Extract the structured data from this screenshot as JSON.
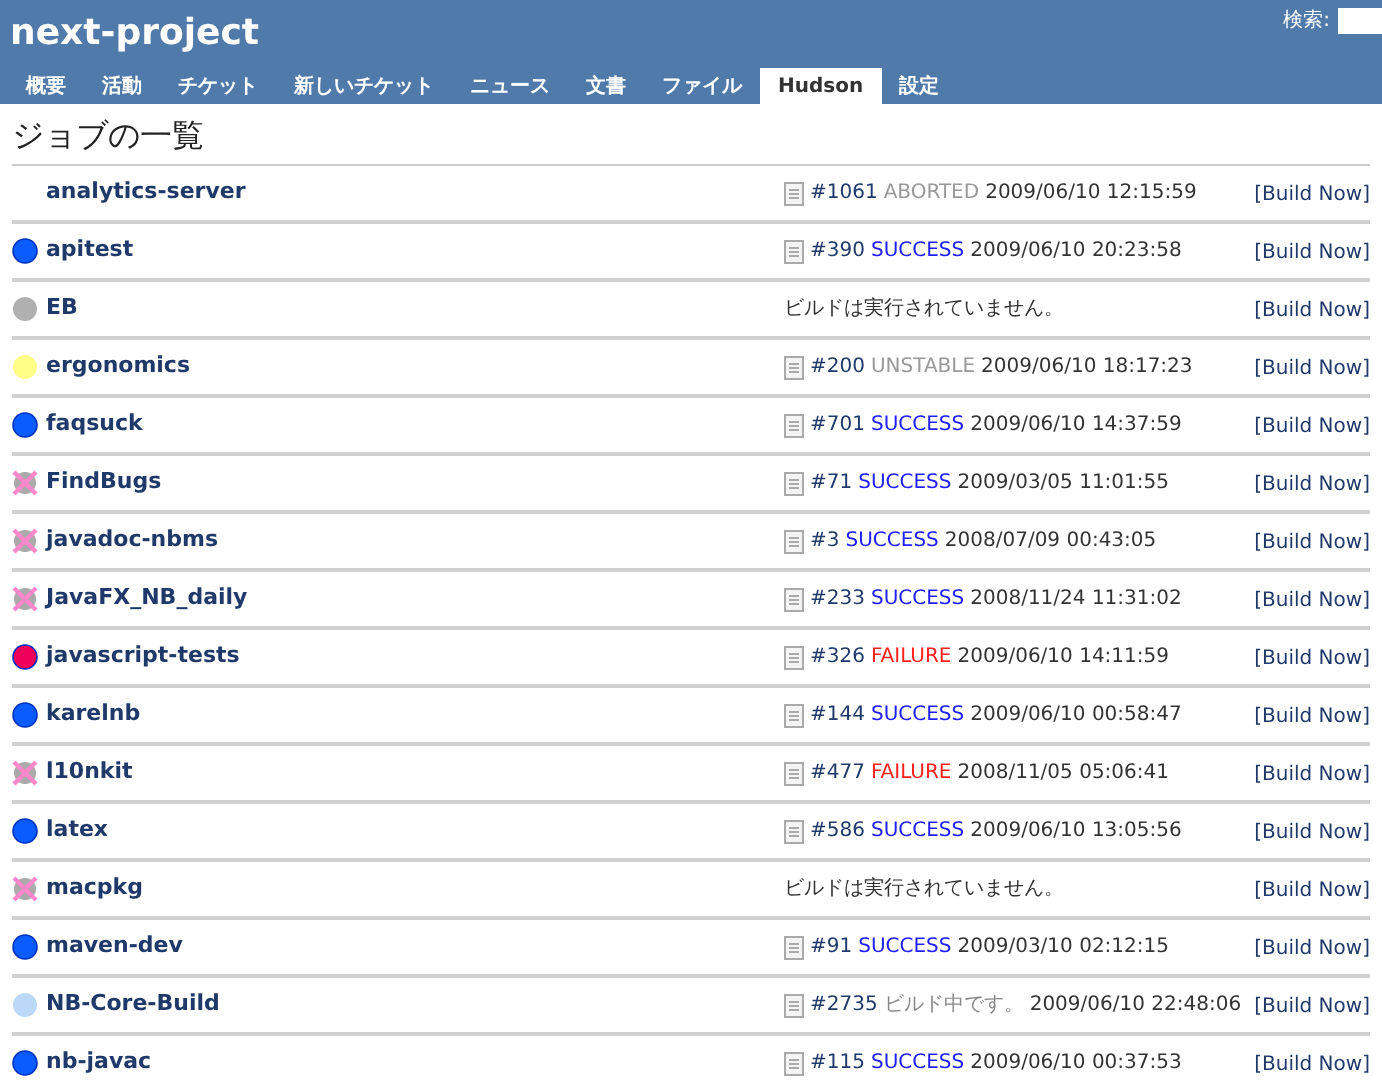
{
  "header": {
    "title": "next-project",
    "search": {
      "label": "検索:"
    }
  },
  "tabs": [
    {
      "label": "概要",
      "selected": false
    },
    {
      "label": "活動",
      "selected": false
    },
    {
      "label": "チケット",
      "selected": false
    },
    {
      "label": "新しいチケット",
      "selected": false
    },
    {
      "label": "ニュース",
      "selected": false
    },
    {
      "label": "文書",
      "selected": false
    },
    {
      "label": "ファイル",
      "selected": false
    },
    {
      "label": "Hudson",
      "selected": true
    },
    {
      "label": "設定",
      "selected": false
    }
  ],
  "heading": "ジョブの一覧",
  "jobs": [
    {
      "name": "analytics-server",
      "kind": "none",
      "build": {
        "number": "#1061",
        "result": "ABORTED",
        "kind": "aborted",
        "time": "2009/06/10 12:15:59"
      },
      "action": "[Build Now]"
    },
    {
      "name": "apitest",
      "kind": "blue",
      "build": {
        "number": "#390",
        "result": "SUCCESS",
        "kind": "success",
        "time": "2009/06/10 20:23:58"
      },
      "action": "[Build Now]"
    },
    {
      "name": "EB",
      "kind": "grey",
      "message": "ビルドは実行されていません。",
      "action": "[Build Now]"
    },
    {
      "name": "ergonomics",
      "kind": "yellow",
      "build": {
        "number": "#200",
        "result": "UNSTABLE",
        "kind": "unstable",
        "time": "2009/06/10 18:17:23"
      },
      "action": "[Build Now]"
    },
    {
      "name": "faqsuck",
      "kind": "blue",
      "build": {
        "number": "#701",
        "result": "SUCCESS",
        "kind": "success",
        "time": "2009/06/10 14:37:59"
      },
      "action": "[Build Now]"
    },
    {
      "name": "FindBugs",
      "kind": "disabled",
      "build": {
        "number": "#71",
        "result": "SUCCESS",
        "kind": "success",
        "time": "2009/03/05 11:01:55"
      },
      "action": "[Build Now]"
    },
    {
      "name": "javadoc-nbms",
      "kind": "disabled",
      "build": {
        "number": "#3",
        "result": "SUCCESS",
        "kind": "success",
        "time": "2008/07/09 00:43:05"
      },
      "action": "[Build Now]"
    },
    {
      "name": "JavaFX_NB_daily",
      "kind": "disabled",
      "build": {
        "number": "#233",
        "result": "SUCCESS",
        "kind": "success",
        "time": "2008/11/24 11:31:02"
      },
      "action": "[Build Now]"
    },
    {
      "name": "javascript-tests",
      "kind": "red",
      "build": {
        "number": "#326",
        "result": "FAILURE",
        "kind": "failure",
        "time": "2009/06/10 14:11:59"
      },
      "action": "[Build Now]"
    },
    {
      "name": "karelnb",
      "kind": "blue",
      "build": {
        "number": "#144",
        "result": "SUCCESS",
        "kind": "success",
        "time": "2009/06/10 00:58:47"
      },
      "action": "[Build Now]"
    },
    {
      "name": "l10nkit",
      "kind": "disabled",
      "build": {
        "number": "#477",
        "result": "FAILURE",
        "kind": "failure",
        "time": "2008/11/05 05:06:41"
      },
      "action": "[Build Now]"
    },
    {
      "name": "latex",
      "kind": "blue",
      "build": {
        "number": "#586",
        "result": "SUCCESS",
        "kind": "success",
        "time": "2009/06/10 13:05:56"
      },
      "action": "[Build Now]"
    },
    {
      "name": "macpkg",
      "kind": "disabled",
      "message": "ビルドは実行されていません。",
      "action": "[Build Now]"
    },
    {
      "name": "maven-dev",
      "kind": "blue",
      "build": {
        "number": "#91",
        "result": "SUCCESS",
        "kind": "success",
        "time": "2009/03/10 02:12:15"
      },
      "action": "[Build Now]"
    },
    {
      "name": "NB-Core-Build",
      "kind": "building",
      "build": {
        "number": "#2735",
        "result": "ビルド中です。",
        "kind": "building",
        "time": "2009/06/10 22:48:06"
      },
      "action": "[Build Now]"
    },
    {
      "name": "nb-javac",
      "kind": "blue",
      "build": {
        "number": "#115",
        "result": "SUCCESS",
        "kind": "success",
        "time": "2009/06/10 00:37:53"
      },
      "action": "[Build Now]"
    }
  ]
}
